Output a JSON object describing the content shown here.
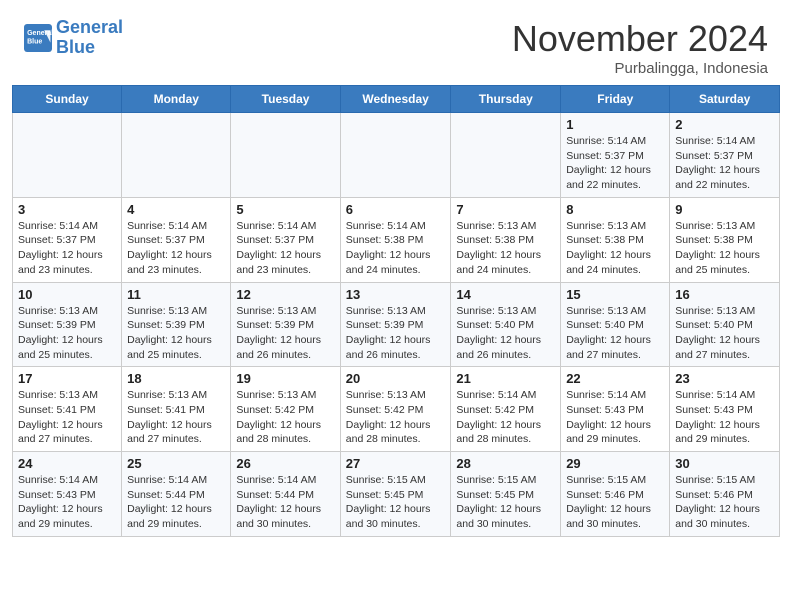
{
  "header": {
    "logo_line1": "General",
    "logo_line2": "Blue",
    "month": "November 2024",
    "location": "Purbalingga, Indonesia"
  },
  "weekdays": [
    "Sunday",
    "Monday",
    "Tuesday",
    "Wednesday",
    "Thursday",
    "Friday",
    "Saturday"
  ],
  "weeks": [
    [
      {
        "day": "",
        "info": ""
      },
      {
        "day": "",
        "info": ""
      },
      {
        "day": "",
        "info": ""
      },
      {
        "day": "",
        "info": ""
      },
      {
        "day": "",
        "info": ""
      },
      {
        "day": "1",
        "info": "Sunrise: 5:14 AM\nSunset: 5:37 PM\nDaylight: 12 hours\nand 22 minutes."
      },
      {
        "day": "2",
        "info": "Sunrise: 5:14 AM\nSunset: 5:37 PM\nDaylight: 12 hours\nand 22 minutes."
      }
    ],
    [
      {
        "day": "3",
        "info": "Sunrise: 5:14 AM\nSunset: 5:37 PM\nDaylight: 12 hours\nand 23 minutes."
      },
      {
        "day": "4",
        "info": "Sunrise: 5:14 AM\nSunset: 5:37 PM\nDaylight: 12 hours\nand 23 minutes."
      },
      {
        "day": "5",
        "info": "Sunrise: 5:14 AM\nSunset: 5:37 PM\nDaylight: 12 hours\nand 23 minutes."
      },
      {
        "day": "6",
        "info": "Sunrise: 5:14 AM\nSunset: 5:38 PM\nDaylight: 12 hours\nand 24 minutes."
      },
      {
        "day": "7",
        "info": "Sunrise: 5:13 AM\nSunset: 5:38 PM\nDaylight: 12 hours\nand 24 minutes."
      },
      {
        "day": "8",
        "info": "Sunrise: 5:13 AM\nSunset: 5:38 PM\nDaylight: 12 hours\nand 24 minutes."
      },
      {
        "day": "9",
        "info": "Sunrise: 5:13 AM\nSunset: 5:38 PM\nDaylight: 12 hours\nand 25 minutes."
      }
    ],
    [
      {
        "day": "10",
        "info": "Sunrise: 5:13 AM\nSunset: 5:39 PM\nDaylight: 12 hours\nand 25 minutes."
      },
      {
        "day": "11",
        "info": "Sunrise: 5:13 AM\nSunset: 5:39 PM\nDaylight: 12 hours\nand 25 minutes."
      },
      {
        "day": "12",
        "info": "Sunrise: 5:13 AM\nSunset: 5:39 PM\nDaylight: 12 hours\nand 26 minutes."
      },
      {
        "day": "13",
        "info": "Sunrise: 5:13 AM\nSunset: 5:39 PM\nDaylight: 12 hours\nand 26 minutes."
      },
      {
        "day": "14",
        "info": "Sunrise: 5:13 AM\nSunset: 5:40 PM\nDaylight: 12 hours\nand 26 minutes."
      },
      {
        "day": "15",
        "info": "Sunrise: 5:13 AM\nSunset: 5:40 PM\nDaylight: 12 hours\nand 27 minutes."
      },
      {
        "day": "16",
        "info": "Sunrise: 5:13 AM\nSunset: 5:40 PM\nDaylight: 12 hours\nand 27 minutes."
      }
    ],
    [
      {
        "day": "17",
        "info": "Sunrise: 5:13 AM\nSunset: 5:41 PM\nDaylight: 12 hours\nand 27 minutes."
      },
      {
        "day": "18",
        "info": "Sunrise: 5:13 AM\nSunset: 5:41 PM\nDaylight: 12 hours\nand 27 minutes."
      },
      {
        "day": "19",
        "info": "Sunrise: 5:13 AM\nSunset: 5:42 PM\nDaylight: 12 hours\nand 28 minutes."
      },
      {
        "day": "20",
        "info": "Sunrise: 5:13 AM\nSunset: 5:42 PM\nDaylight: 12 hours\nand 28 minutes."
      },
      {
        "day": "21",
        "info": "Sunrise: 5:14 AM\nSunset: 5:42 PM\nDaylight: 12 hours\nand 28 minutes."
      },
      {
        "day": "22",
        "info": "Sunrise: 5:14 AM\nSunset: 5:43 PM\nDaylight: 12 hours\nand 29 minutes."
      },
      {
        "day": "23",
        "info": "Sunrise: 5:14 AM\nSunset: 5:43 PM\nDaylight: 12 hours\nand 29 minutes."
      }
    ],
    [
      {
        "day": "24",
        "info": "Sunrise: 5:14 AM\nSunset: 5:43 PM\nDaylight: 12 hours\nand 29 minutes."
      },
      {
        "day": "25",
        "info": "Sunrise: 5:14 AM\nSunset: 5:44 PM\nDaylight: 12 hours\nand 29 minutes."
      },
      {
        "day": "26",
        "info": "Sunrise: 5:14 AM\nSunset: 5:44 PM\nDaylight: 12 hours\nand 30 minutes."
      },
      {
        "day": "27",
        "info": "Sunrise: 5:15 AM\nSunset: 5:45 PM\nDaylight: 12 hours\nand 30 minutes."
      },
      {
        "day": "28",
        "info": "Sunrise: 5:15 AM\nSunset: 5:45 PM\nDaylight: 12 hours\nand 30 minutes."
      },
      {
        "day": "29",
        "info": "Sunrise: 5:15 AM\nSunset: 5:46 PM\nDaylight: 12 hours\nand 30 minutes."
      },
      {
        "day": "30",
        "info": "Sunrise: 5:15 AM\nSunset: 5:46 PM\nDaylight: 12 hours\nand 30 minutes."
      }
    ]
  ]
}
